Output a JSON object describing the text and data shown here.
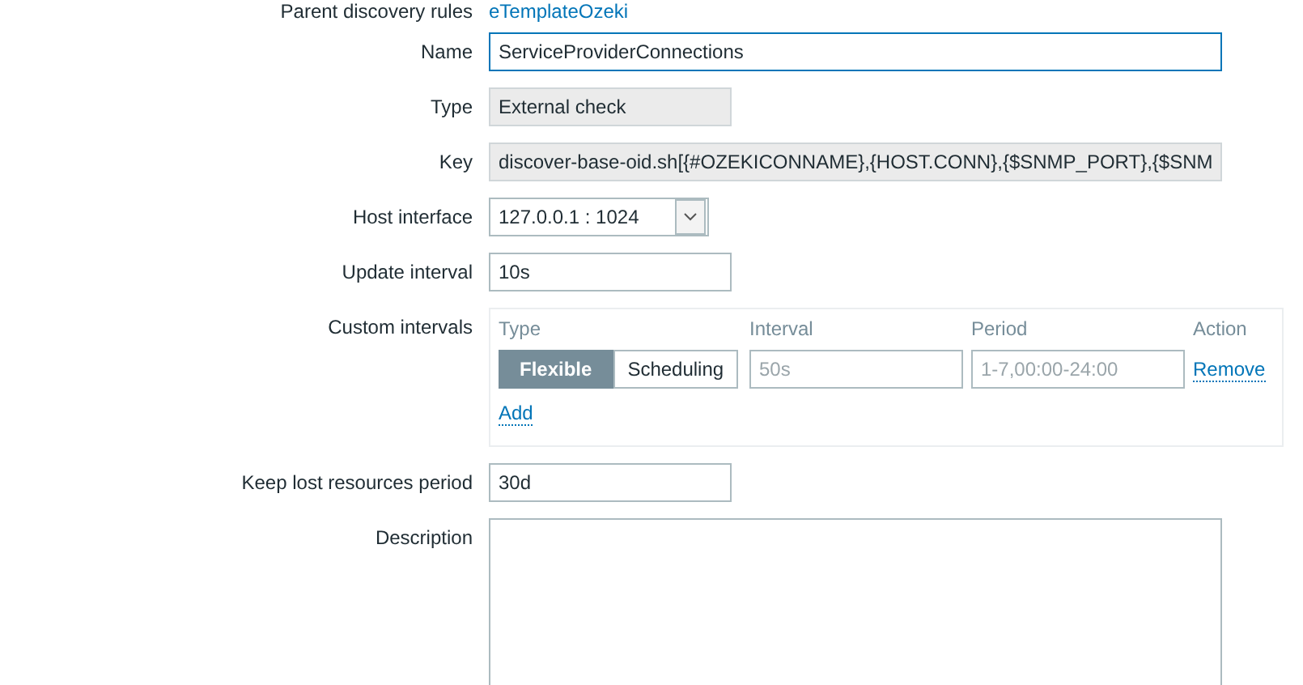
{
  "parent_rule": {
    "label": "Parent discovery rules",
    "value": "eTemplateOzeki"
  },
  "fields": [
    {
      "kind": "wide_text",
      "label": "Name",
      "value": "ServiceProviderConnections",
      "readonly": false,
      "focused": true
    },
    {
      "kind": "text",
      "label": "Type",
      "value": "External check",
      "readonly": true,
      "focused": false
    },
    {
      "kind": "wide_text",
      "label": "Key",
      "value": "discover-base-oid.sh[{#OZEKICONNAME},{HOST.CONN},{$SNMP_PORT},{$SNM",
      "readonly": true,
      "focused": false
    },
    {
      "kind": "select",
      "label": "Host interface",
      "value": "127.0.0.1 : 1024"
    },
    {
      "kind": "text",
      "label": "Update interval",
      "value": "10s",
      "readonly": false,
      "focused": false
    },
    {
      "kind": "intervals",
      "label": "Custom intervals",
      "columns": [
        "Type",
        "Interval",
        "Period",
        "Action"
      ],
      "rows": [
        {
          "modes": [
            {
              "label": "Flexible",
              "selected": true
            },
            {
              "label": "Scheduling",
              "selected": false
            }
          ],
          "interval_placeholder": "50s",
          "period_placeholder": "1-7,00:00-24:00",
          "action": "Remove"
        }
      ],
      "add": "Add"
    },
    {
      "kind": "text",
      "label": "Keep lost resources period",
      "value": "30d",
      "readonly": false,
      "focused": false
    },
    {
      "kind": "textarea",
      "label": "Description"
    }
  ]
}
